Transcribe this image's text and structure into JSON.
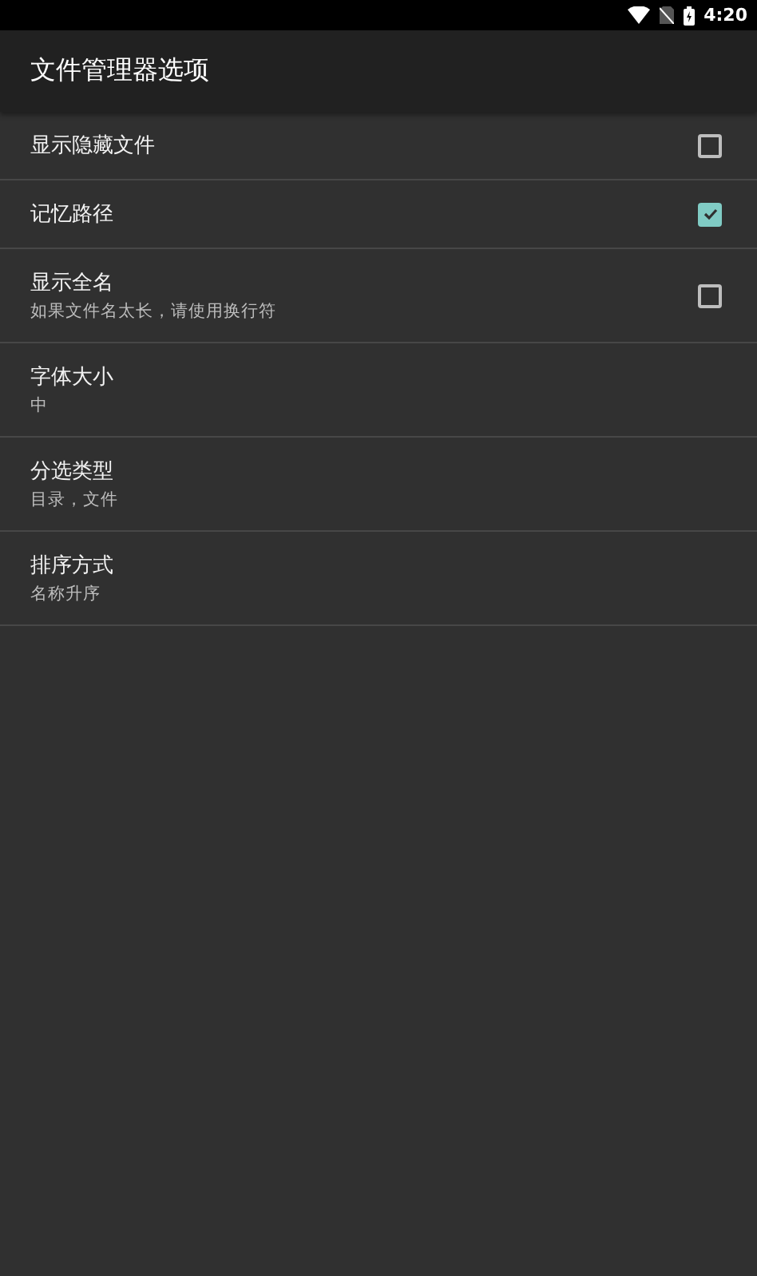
{
  "status_bar": {
    "time": "4:20"
  },
  "app_bar": {
    "title": "文件管理器选项"
  },
  "settings": [
    {
      "kind": "checkbox",
      "title": "显示隐藏文件",
      "checked": false
    },
    {
      "kind": "checkbox",
      "title": "记忆路径",
      "checked": true
    },
    {
      "kind": "checkbox",
      "title": "显示全名",
      "summary": "如果文件名太长，请使用换行符",
      "checked": false
    },
    {
      "kind": "choice",
      "title": "字体大小",
      "summary": "中"
    },
    {
      "kind": "choice",
      "title": "分选类型",
      "summary": "目录，文件"
    },
    {
      "kind": "choice",
      "title": "排序方式",
      "summary": "名称升序"
    }
  ]
}
